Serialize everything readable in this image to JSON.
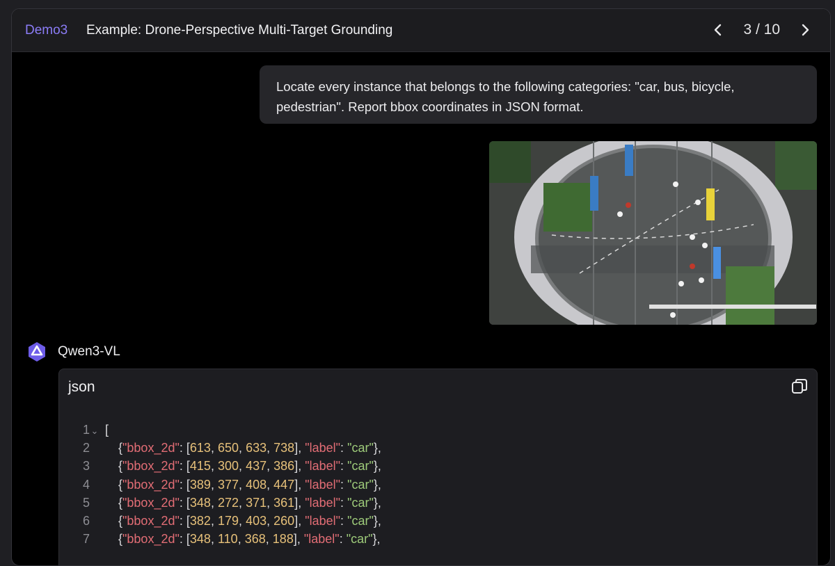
{
  "header": {
    "demo_tag": "Demo3",
    "title": "Example: Drone-Perspective Multi-Target Grounding",
    "page_indicator": "3 / 10"
  },
  "user_message": {
    "text": "Locate every instance that belongs to the following categories: \"car, bus, bicycle, pedestrian\". Report bbox coordinates in JSON format."
  },
  "assistant": {
    "name": "Qwen3-VL",
    "code_language": "json",
    "code_lines": [
      {
        "num": "1",
        "text": "["
      },
      {
        "num": "2",
        "text": "{\"bbox_2d\": [613, 650, 633, 738], \"label\": \"car\"},"
      },
      {
        "num": "3",
        "text": "{\"bbox_2d\": [415, 300, 437, 386], \"label\": \"car\"},"
      },
      {
        "num": "4",
        "text": "{\"bbox_2d\": [389, 377, 408, 447], \"label\": \"car\"},"
      },
      {
        "num": "5",
        "text": "{\"bbox_2d\": [348, 272, 371, 361], \"label\": \"car\"},"
      },
      {
        "num": "6",
        "text": "{\"bbox_2d\": [382, 179, 403, 260], \"label\": \"car\"},"
      },
      {
        "num": "7",
        "text": "{\"bbox_2d\": [348, 110, 368, 188], \"label\": \"car\"},"
      }
    ]
  },
  "icons": {
    "prev": "chevron-left-icon",
    "next": "chevron-right-icon",
    "copy": "copy-icon",
    "logo": "qwen-logo-icon",
    "fold": "chevron-down-icon"
  },
  "colors": {
    "accent": "#8b7cf6",
    "json_key": "#e26d75",
    "json_number": "#e7c17a",
    "json_string": "#9ecb7a"
  }
}
